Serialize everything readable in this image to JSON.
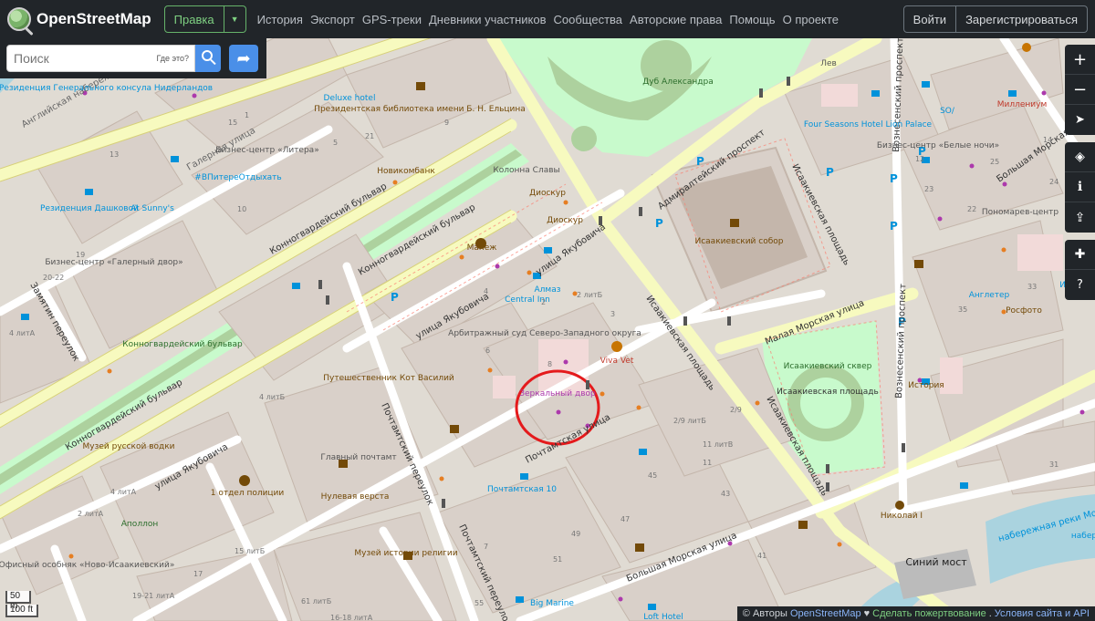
{
  "header": {
    "logo_text": "OpenStreetMap",
    "edit_label": "Правка",
    "nav": [
      "История",
      "Экспорт",
      "GPS-треки",
      "Дневники участников",
      "Сообщества",
      "Авторские права",
      "Помощь",
      "О проекте"
    ],
    "login_label": "Войти",
    "signup_label": "Зарегистрироваться"
  },
  "search": {
    "placeholder": "Поиск",
    "where_label": "Где это?"
  },
  "controls": {
    "zoom_in": "+",
    "zoom_out": "−"
  },
  "scale": {
    "metric": "50 m",
    "imperial": "100 ft"
  },
  "attribution": {
    "copyright": "© Авторы",
    "osm": "OpenStreetMap",
    "heart": "♥",
    "donate": "Сделать пожертвование",
    "terms": "Условия сайта и API"
  },
  "map": {
    "labels": {
      "anglijskaya": "Английская набережная",
      "residence_nl": "Резиденция Генерального консула Нидерландов",
      "deluxe": "Deluxe hotel",
      "presidential_lib": "Президентская библиотека имени Б. Н. Ельцина",
      "dub": "Дуб Александра",
      "lev": "Лев",
      "four_seasons": "Four Seasons Hotel Lion Palace",
      "so": "SO/",
      "millennium": "Миллениум",
      "voznesensky": "Вознесенский проспект",
      "galernaya": "Галерная улица",
      "biz_litera": "Бизнес-центр «Литера»",
      "vpitere": "#ВПитереОтдыхать",
      "novikom": "Новикомбанк",
      "kolonna": "Колонна Славы",
      "admiralteysky": "Адмиралтейский проспект",
      "isaac_square": "Исаакиевская площадь",
      "biz_belye": "Бизнес-центр «Белые ночи»",
      "bolshaya_morskaya_ne": "Большая Морская улица",
      "residence_dashkovoy": "Резиденция Дашковой",
      "at_sunnys": "At Sunny's",
      "diosur1": "Диоскур",
      "diosur2": "Диоскур",
      "ponomarev": "Пономарев-центр",
      "konnogvard1": "Конногвардейский бульвар",
      "manezh": "Манеж",
      "isaac_cathedral": "Исаакиевский собор",
      "biz_galerny": "Бизнес-центр «Галерный двор»",
      "yakubovicha1": "улица Якубовича",
      "almaz": "Алмаз",
      "central_inn": "Central Inn",
      "malaya_morskaya": "Малая Морская улица",
      "angleter": "Англетер",
      "rosfoto": "Росфото",
      "irena": "Ирена",
      "zamyatin": "Замятин переулок",
      "konnogvard_park": "Конногвардейский бульвар",
      "arbitrazh": "Арбитражный суд Северо-Западного округа",
      "viva_vet": "Viva Vet",
      "isaak_skver": "Исаакиевский сквер",
      "isaak_ploshad": "Исаакиевская площадь",
      "isaak_pl_s": "Исаакиевская площадь",
      "voznes_s": "Вознесенский проспект",
      "istoria": "История",
      "kot_vasily": "Путешественник Кот Василий",
      "zerkalny": "Зеркальный двор",
      "pochtamtsky_per": "Почтамтский переулок",
      "pochtamtskaya": "Почтамтская улица",
      "konnogvard2": "Конногвардейский бульвар",
      "museum_vodka": "Музей русской водки",
      "glavny_pochtamt": "Главный почтамт",
      "nulevaya": "Нулевая верста",
      "yakubovicha2": "улица Якубовича",
      "otdel_policii": "1 отдел полиции",
      "pochtamtskaya10": "Почтамтская 10",
      "isaak_big": "Исаакиевская площадь",
      "nikolay": "Николай I",
      "apollon": "Аполлон",
      "museum_religion": "Музей истории религии",
      "pochtamtsky_per2": "Почтамтский переулок",
      "bolshaya_morskaya": "Большая Морская улица",
      "siniy_most": "Синий мост",
      "office_novo": "Офисный особняк «Ново-Исаакиевский»",
      "big_marine": "Big Marine",
      "loft": "Loft Hotel",
      "moyka": "набережная реки Мойки",
      "nabere": "набер",
      "istoria2": "История",
      "so_2": "Ист",
      "n_2lit": "2 литБ",
      "n_29": "2/9",
      "n_29lit": "2/9 литБ",
      "n_11lit": "11 литВ",
      "n_4lit": "4 литБ",
      "n_4litA": "4 литА",
      "n_2022": "20-22",
      "n_1921": "19-21 литА",
      "n_61": "61 литБ",
      "n_1618": "16-18 литА",
      "n_55": "55",
      "n_49": "49",
      "n_51": "51",
      "n_47": "47",
      "n_45": "45",
      "n_43": "43",
      "n_41": "41",
      "n_33": "33",
      "n_35": "35",
      "n_5": "5",
      "n_6": "6",
      "n_8": "8",
      "n_7": "7",
      "n_9": "9",
      "n_1": "1",
      "n_3": "3",
      "n_2": "2",
      "n_4": "4",
      "n_10": "10",
      "n_12": "12",
      "n_14": "14",
      "n_15": "15",
      "n_15lit": "15 литБ",
      "n_22": "22",
      "n_23": "23",
      "n_24": "24",
      "n_25": "25",
      "n_31": "31",
      "n_17": "17",
      "n_19": "19",
      "n_21": "21",
      "n_13": "13",
      "n_11": "11",
      "n_3lit": "3",
      "n_4litB": "4 литА",
      "n_2litA": "2 литА"
    }
  }
}
